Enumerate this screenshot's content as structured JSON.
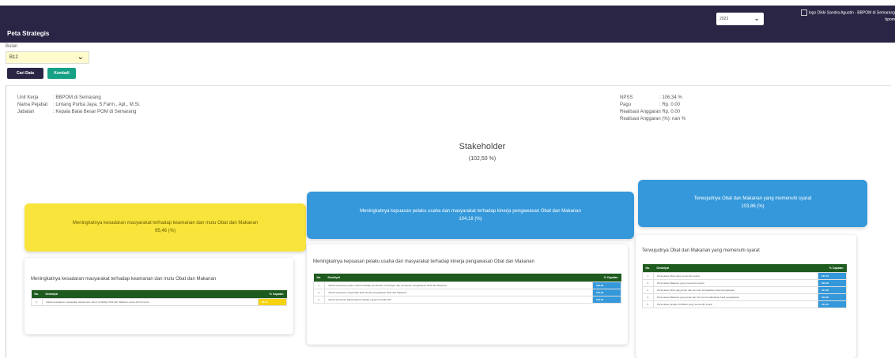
{
  "header": {
    "title": "Peta Strategis",
    "year_select": "2023",
    "user_text": "logo Dikki Sandra Agustin - BBPOM di Semarang",
    "user_text_2": "bpom"
  },
  "filter": {
    "bulan_label": "Bulan",
    "bulan_value": "B12",
    "cari_label": "Cari Data",
    "kembali_label": "Kembali"
  },
  "info_left": {
    "unit_kerja_label": "Unit Kerja",
    "unit_kerja_value": ": BBPOM di Semarang",
    "nama_label": "Nama Pejabat",
    "nama_value": ": Lintang Purba Jaya, S.Farm., Apt., M.Si.",
    "jabatan_label": "Jabatan",
    "jabatan_value": ": Kepala Balai Besar POM di Semarang"
  },
  "info_right": {
    "npss_label": "NPSS",
    "npss_value": ": 106,34 %",
    "pagu_label": "Pagu",
    "pagu_value": ": Rp. 0.00",
    "realisasi_label": "Realisasi Anggaran",
    "realisasi_value": ": Rp. 0.00",
    "realisasi_pct_label": "Realisasi Anggaran (%)",
    "realisasi_pct_value": ": nan %"
  },
  "stakeholder": {
    "title": "Stakeholder",
    "value": "(102,50 %)"
  },
  "goals": [
    {
      "title": "Meningkatnya kesadaran masyarakat terhadap keamanan dan mutu Obat dan Makanan",
      "value": "95,46 (%)",
      "color": "#f8e43a"
    },
    {
      "title": "Meningkatnya kepuasan pelaku usaha dan masyarakat terhadap kinerja pengawasan Obat dan Makanan",
      "value": "104,18 (%)",
      "color": "#3498db"
    },
    {
      "title": "Terwujudnya Obat dan Makanan yang memenuhi syarat",
      "value": "103,86 (%)",
      "color": "#3498db"
    }
  ],
  "table_headers": {
    "no": "No.",
    "deskripsi": "Deskripsi",
    "capaian": "% Capaian"
  },
  "cards": [
    {
      "title": "Meningkatnya kesadaran masyarakat terhadap keamanan dan mutu Obat dan Makanan",
      "rows": [
        {
          "no": "1.",
          "desc": "Indeks kesadaran masyarakat (awareness index) terhadap Obat dan Makanan aman dan bermutu",
          "pct": "95,46",
          "color": "#f5d30f"
        }
      ]
    },
    {
      "title": "Meningkatnya kepuasan pelaku usaha dan masyarakat terhadap kinerja pengawasan Obat dan Makanan",
      "rows": [
        {
          "no": "1.",
          "desc": "Indeks kepuasan pelaku usaha terhadap pembinaan, bimbingan dan pemberian pengawasan Obat dan Makanan",
          "pct": "100,00",
          "color": "#3498db"
        },
        {
          "no": "2.",
          "desc": "Indeks kepuasan masyarakat atas kinerja pengawasan Obat dan Makanan",
          "pct": "100,00",
          "color": "#3498db"
        },
        {
          "no": "3.",
          "desc": "Indeks Kepuasan Masyarakat terhadap Layanan Publik UPT",
          "pct": "102,53",
          "color": "#3498db"
        }
      ]
    },
    {
      "title": "Terwujudnya Obat dan Makanan yang memenuhi syarat",
      "rows": [
        {
          "no": "1.",
          "desc": "Persentase Obat yang memenuhi syarat",
          "pct": "101,72",
          "color": "#3498db"
        },
        {
          "no": "2.",
          "desc": "Persentase Makanan yang memenuhi syarat",
          "pct": "100,00",
          "color": "#3498db"
        },
        {
          "no": "3.",
          "desc": "Persentase Obat yang aman dan bermutu berdasarkan hasil pengawasan",
          "pct": "101,20",
          "color": "#3498db"
        },
        {
          "no": "4.",
          "desc": "Persentase Makanan yang aman dan bermutu berdasarkan hasil pengawasan",
          "pct": "100,00",
          "color": "#3498db"
        },
        {
          "no": "5.",
          "desc": "Persentase pangan fortifikasi yang memenuhi syarat",
          "pct": "104,51",
          "color": "#3498db"
        }
      ]
    }
  ]
}
